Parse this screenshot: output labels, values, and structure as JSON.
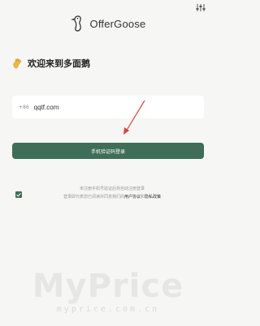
{
  "app": {
    "logo_text": "OfferGoose"
  },
  "welcome": {
    "text": "欢迎来到多面鹅"
  },
  "phone": {
    "country_code": "+86",
    "value": "qqtf.com"
  },
  "login": {
    "button_label": "手机验证码登录"
  },
  "agreement": {
    "checked": true,
    "line1": "未注册手机号验证后将自动注册登录",
    "line2_prefix": "登录即代表您已阅读并同意我们的",
    "user_agreement": "用户协议",
    "conjunction": "和",
    "privacy_policy": "隐私政策"
  },
  "watermark": {
    "big": "MyPrice",
    "small": "myprice.com.cn"
  },
  "colors": {
    "accent": "#3e6e57",
    "background": "#f6f6f4",
    "annotation_arrow": "#d9433a"
  },
  "icons": {
    "settings": "sliders-icon",
    "logo": "goose-logo-icon",
    "wave": "waving-hand-icon",
    "check": "check-icon"
  }
}
